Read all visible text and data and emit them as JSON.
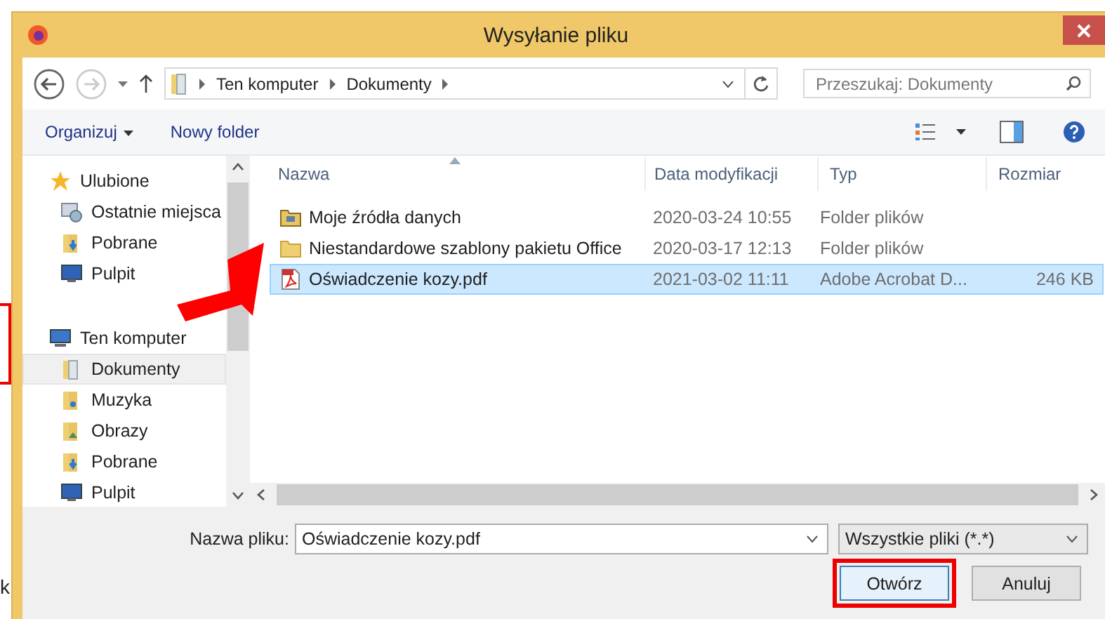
{
  "window": {
    "title": "Wysyłanie pliku"
  },
  "background_page": {
    "text": "k"
  },
  "address_bar": {
    "path": [
      "Ten komputer",
      "Dokumenty"
    ]
  },
  "search": {
    "placeholder": "Przeszukaj: Dokumenty"
  },
  "toolbar": {
    "buttons": [
      {
        "label": "Organizuj",
        "kind": "menu"
      },
      {
        "label": "Nowy folder",
        "kind": "plain"
      }
    ]
  },
  "sidebar": {
    "items": [
      {
        "label": "Ulubione",
        "kind": "star",
        "selected": false,
        "children": [
          {
            "label": "Ostatnie miejsca",
            "kind": "recent",
            "selected": false
          },
          {
            "label": "Pobrane",
            "kind": "downloads",
            "selected": false
          },
          {
            "label": "Pulpit",
            "kind": "desktop",
            "selected": false
          }
        ]
      },
      {
        "label": "Ten komputer",
        "kind": "computer",
        "selected": false,
        "children": [
          {
            "label": "Dokumenty",
            "kind": "documents",
            "selected": true
          },
          {
            "label": "Muzyka",
            "kind": "music",
            "selected": false
          },
          {
            "label": "Obrazy",
            "kind": "pictures",
            "selected": false
          },
          {
            "label": "Pobrane",
            "kind": "downloads",
            "selected": false
          },
          {
            "label": "Pulpit",
            "kind": "desktop",
            "selected": false
          }
        ]
      }
    ]
  },
  "file_list": {
    "columns": [
      "Nazwa",
      "Data modyfikacji",
      "Typ",
      "Rozmiar"
    ],
    "rows": [
      {
        "name": "Moje źródła danych",
        "date": "2020-03-24 10:55",
        "type": "Folder plików",
        "kind": "special-folder",
        "selected": false
      },
      {
        "name": "Niestandardowe szablony pakietu Office",
        "date": "2020-03-17 12:13",
        "type": "Folder plików",
        "kind": "folder",
        "selected": false
      },
      {
        "name": "Oświadczenie kozy.pdf",
        "date": "2021-03-02 11:11",
        "type": "Adobe Acrobat D...",
        "size": "246 KB",
        "kind": "pdf",
        "selected": true
      }
    ]
  },
  "file_name": {
    "label": "Nazwa pliku:",
    "value": "Oświadczenie kozy.pdf"
  },
  "file_type": {
    "value": "Wszystkie pliki (*.*)"
  },
  "buttons": [
    {
      "label": "Otwórz",
      "highlighted": true
    },
    {
      "label": "Anuluj",
      "highlighted": false
    }
  ]
}
